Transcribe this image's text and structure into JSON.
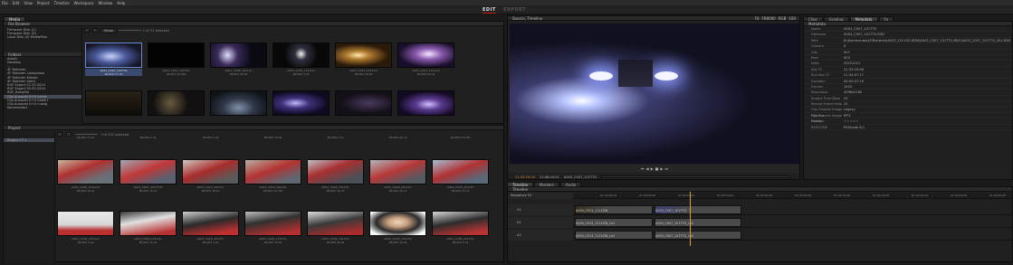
{
  "menu": [
    "File",
    "Edit",
    "View",
    "Project",
    "Timeline",
    "Workspace",
    "Window",
    "Help"
  ],
  "modes": {
    "edit": "EDIT",
    "export": "EXPORT"
  },
  "media_tab": "Media",
  "browser": {
    "title": "File Browser",
    "drives": [
      "Firmware Disk (C)",
      "Firmware Disk (D)",
      "Local Disk (E) MediaFiles"
    ],
    "clip_count": "1 of 21 selected",
    "show_label": "Show",
    "folders_title": "Folders",
    "folders": [
      "Admin",
      "Desktop",
      "...",
      "4F Rohdreh",
      "4F Rohdreh Landphase",
      "4F Rohdreh Master",
      "4F Rohdreh StarC",
      "RGF Export 21.03.2014",
      "RGF Export 30.03.2014",
      "RGF_Basisfile",
      "Clip Auswahl K+G Lehre",
      "Clip Auswahl K+H Seefirt",
      "Clip Auswahl K+G Lustig",
      "Kommando1"
    ],
    "thumbs": [
      {
        "name": "A001_C022_101TTG",
        "tc": "96.0KS  57.4s"
      },
      {
        "name": "A001_C021_101TTG",
        "tc": "96.0KS  59.40s"
      },
      {
        "name": "A001_C008_10113n",
        "tc": "96.0KS  55.6s"
      },
      {
        "name": "A001_C005_1011TG",
        "tc": "96.0KS  3.4s"
      },
      {
        "name": "A001_C014_1011TG",
        "tc": "96.0KS  20.6s"
      },
      {
        "name": "A001_C021_10111G",
        "tc": "96.0KS  29.4s"
      }
    ]
  },
  "project": {
    "title": "Project",
    "count": "1 of 102 selected",
    "root": "Project CT 1",
    "top_caps": [
      "96.0KS  17.2s",
      "96.0KS  2.3s",
      "96.0KS  1.4s",
      "96.0KS  10.4s",
      "96.0KS  2.7s",
      "96.0KS  21.1s",
      "96.0KS  24.16s"
    ],
    "row1": [
      {
        "name": "A001_C006_101GCG",
        "tc": "96.0KS  16.3s"
      },
      {
        "name": "A001_C007_1011TTE",
        "tc": "96.0KS  15.7s"
      },
      {
        "name": "A001_C013_1011TC",
        "tc": "96.0KS  16.1s"
      },
      {
        "name": "A001_C019_1011ZL",
        "tc": "96.0KS  12.75s"
      },
      {
        "name": "A001_C028_1011TG",
        "tc": "96.0KS  10.7s"
      },
      {
        "name": "A001_C029_1011TG",
        "tc": "96.0KS  10.1s"
      },
      {
        "name": "A001_C033_1011FF",
        "tc": "96.0KS  13.7s"
      }
    ],
    "row2": [
      {
        "name": "A001_C002_1011LO",
        "tc": "96.0KS  3.4s"
      },
      {
        "name": "A001_C009_10111G",
        "tc": "96.0KS  11.2s"
      },
      {
        "name": "A001_C018_1011TC",
        "tc": "96.0KS  4.4s"
      },
      {
        "name": "A001_C025_1011TG",
        "tc": "96.0KS  12.5s"
      },
      {
        "name": "A001_C034_1011TG",
        "tc": "96.0KS  40.4s"
      },
      {
        "name": "A001_C035_1011TG",
        "tc": "96.0KS  16.6s"
      },
      {
        "name": "A001_C036_1011TG",
        "tc": "96.0KS  6.2s"
      }
    ]
  },
  "viewer": {
    "title": "Source, Timeline",
    "timecode_in": "21:33:29:24",
    "timecode_out": "21:48:43:01",
    "clip_name": "A003_C007_101TTG",
    "fit": "Fit",
    "format": "FR8000",
    "color": "RGB",
    "zoom": "100"
  },
  "metadata": {
    "tabs": [
      "Clips",
      "Grading",
      "Metadata",
      "Fx"
    ],
    "active_tab": "Metadata",
    "title": "Metadata",
    "rows": [
      {
        "k": "Name",
        "v": "A003_C007_101TTG"
      },
      {
        "k": "Filename",
        "v": "A003_C007_101TTG.R3D"
      },
      {
        "k": "Path",
        "v": "B:\\Kommando\\4F\\Rohdreh\\A003_1011SG.RDM\\A003_C007_101TTG.RDC\\A003_C007_101TTG_001.R3D"
      },
      {
        "k": "Camera",
        "v": "A"
      },
      {
        "k": "Clip",
        "v": "007"
      },
      {
        "k": "Reel",
        "v": "003"
      },
      {
        "k": "Date",
        "v": "20101011"
      },
      {
        "k": "Abs TC",
        "v": "21:33:29:08"
      },
      {
        "k": "End Abs TC",
        "v": "21:34:57:17"
      },
      {
        "k": "Duration",
        "v": "00:00:57:19"
      },
      {
        "k": "Frames",
        "v": "1403"
      },
      {
        "k": "Resolution",
        "v": "4096x2160"
      },
      {
        "k": "Project Time Base",
        "v": "25"
      },
      {
        "k": "Record Frame Rate",
        "v": "25"
      },
      {
        "k": "Clip Original Image Pipeline",
        "v": "Legacy"
      },
      {
        "k": "Clip Current Image Pipeline",
        "v": "IPP2"
      },
      {
        "k": "Rating",
        "v": "☆☆☆☆☆"
      },
      {
        "k": "REDCODE",
        "v": "REDcode 8:1"
      }
    ]
  },
  "timeline": {
    "tabs": [
      "Timeline",
      "Markers",
      "Audio"
    ],
    "title": "Timeline",
    "sequence": "Sequence 01",
    "ruler": [
      "01:00:04:20",
      "01:00:09:20",
      "01:00:14:20",
      "01:00:19:20",
      "01:00:24:20",
      "01:00:29:20",
      "01:00:34:20",
      "01:00:39:20",
      "01:00:44:20",
      "01:00:49:20",
      "01:00:54:20"
    ],
    "tracks": [
      {
        "label": "V1",
        "clip1": "A004_C013_1111ZW",
        "clip2": "A003_C007_101TTG"
      },
      {
        "label": "A1",
        "clip1": "A004_C013_1111ZW_ch1",
        "clip2": "A003_C007_101TTG_ch1"
      },
      {
        "label": "A2",
        "clip1": "A004_C013_1111ZW_ch2",
        "clip2": "A003_C007_101TTG_ch2"
      }
    ]
  },
  "colors": {
    "accent": "#c21a1a",
    "selected": "#454b55",
    "playhead": "#e0a020"
  }
}
